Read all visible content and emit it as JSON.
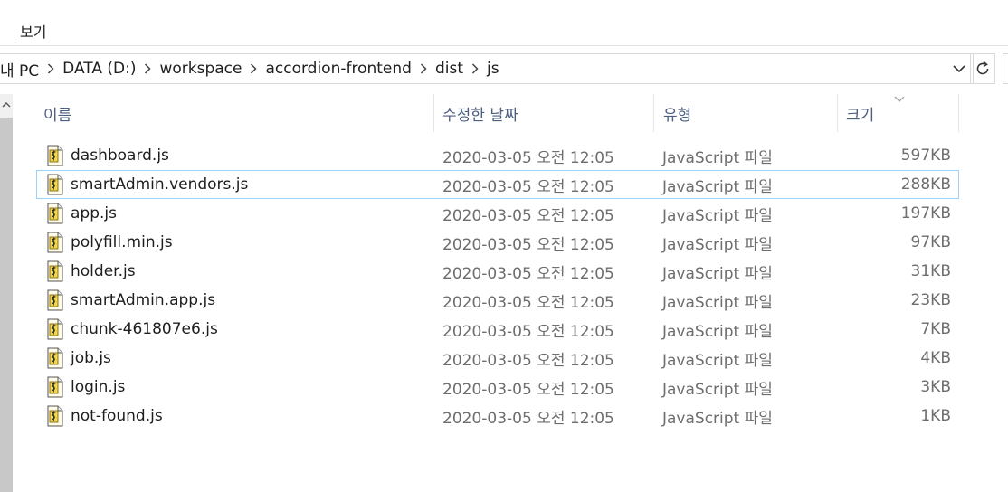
{
  "menu": {
    "view_label": "보기"
  },
  "breadcrumb": {
    "items": [
      "내 PC",
      "DATA (D:)",
      "workspace",
      "accordion-frontend",
      "dist",
      "js"
    ]
  },
  "columns": {
    "name": "이름",
    "date_modified": "수정한 날짜",
    "type": "유형",
    "size": "크기",
    "sort_column": "size",
    "sort_direction": "descending"
  },
  "files": [
    {
      "name": "dashboard.js",
      "date": "2020-03-05 오전 12:05",
      "type": "JavaScript 파일",
      "size": "597KB",
      "icon": "js-file-icon"
    },
    {
      "name": "smartAdmin.vendors.js",
      "date": "2020-03-05 오전 12:05",
      "type": "JavaScript 파일",
      "size": "288KB",
      "icon": "js-file-icon",
      "selected": true
    },
    {
      "name": "app.js",
      "date": "2020-03-05 오전 12:05",
      "type": "JavaScript 파일",
      "size": "197KB",
      "icon": "js-file-icon"
    },
    {
      "name": "polyfill.min.js",
      "date": "2020-03-05 오전 12:05",
      "type": "JavaScript 파일",
      "size": "97KB",
      "icon": "js-file-icon"
    },
    {
      "name": "holder.js",
      "date": "2020-03-05 오전 12:05",
      "type": "JavaScript 파일",
      "size": "31KB",
      "icon": "js-file-icon"
    },
    {
      "name": "smartAdmin.app.js",
      "date": "2020-03-05 오전 12:05",
      "type": "JavaScript 파일",
      "size": "23KB",
      "icon": "js-file-icon"
    },
    {
      "name": "chunk-461807e6.js",
      "date": "2020-03-05 오전 12:05",
      "type": "JavaScript 파일",
      "size": "7KB",
      "icon": "js-file-icon"
    },
    {
      "name": "job.js",
      "date": "2020-03-05 오전 12:05",
      "type": "JavaScript 파일",
      "size": "4KB",
      "icon": "js-file-icon"
    },
    {
      "name": "login.js",
      "date": "2020-03-05 오전 12:05",
      "type": "JavaScript 파일",
      "size": "3KB",
      "icon": "js-file-icon"
    },
    {
      "name": "not-found.js",
      "date": "2020-03-05 오전 12:05",
      "type": "JavaScript 파일",
      "size": "1KB",
      "icon": "js-file-icon"
    }
  ],
  "colors": {
    "selection_border": "#99d1ff",
    "header_text": "#4d6082",
    "meta_text": "#6d6d6d"
  }
}
